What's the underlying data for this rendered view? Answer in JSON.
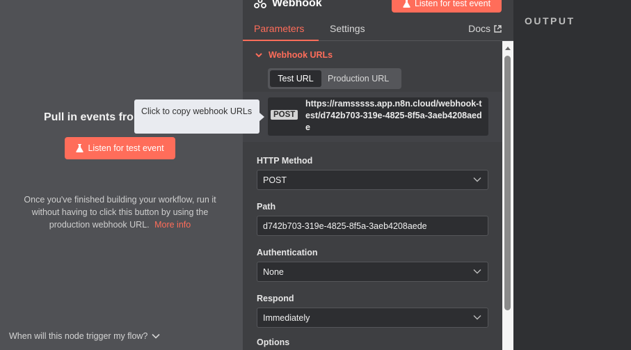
{
  "input_panel": {
    "title": "Pull in events fro",
    "listen_button": "Listen for test event",
    "description": "Once you've finished building your workflow, run it without having to click this button by using the production webhook URL.",
    "more_info": "More info",
    "footer_question": "When will this node trigger my flow?"
  },
  "tooltip": {
    "text": "Click to copy webhook URLs"
  },
  "node": {
    "title": "Webhook",
    "listen_button": "Listen for test event",
    "tabs": {
      "parameters": "Parameters",
      "settings": "Settings",
      "docs": "Docs"
    },
    "webhook_urls": {
      "heading": "Webhook URLs",
      "tabs": {
        "test": "Test URL",
        "production": "Production URL"
      },
      "method": "POST",
      "url": "https://ramsssss.app.n8n.cloud/webhook-test/d742b703-319e-4825-8f5a-3aeb4208aede"
    },
    "fields": {
      "http_method": {
        "label": "HTTP Method",
        "value": "POST"
      },
      "path": {
        "label": "Path",
        "value": "d742b703-319e-4825-8f5a-3aeb4208aede"
      },
      "authentication": {
        "label": "Authentication",
        "value": "None"
      },
      "respond": {
        "label": "Respond",
        "value": "Immediately"
      },
      "options": {
        "label": "Options"
      }
    }
  },
  "output_panel": {
    "title": "OUTPUT"
  },
  "colors": {
    "accent": "#ff6d5a",
    "panel": "#3e3f42",
    "input_bg": "#2d2e31"
  }
}
